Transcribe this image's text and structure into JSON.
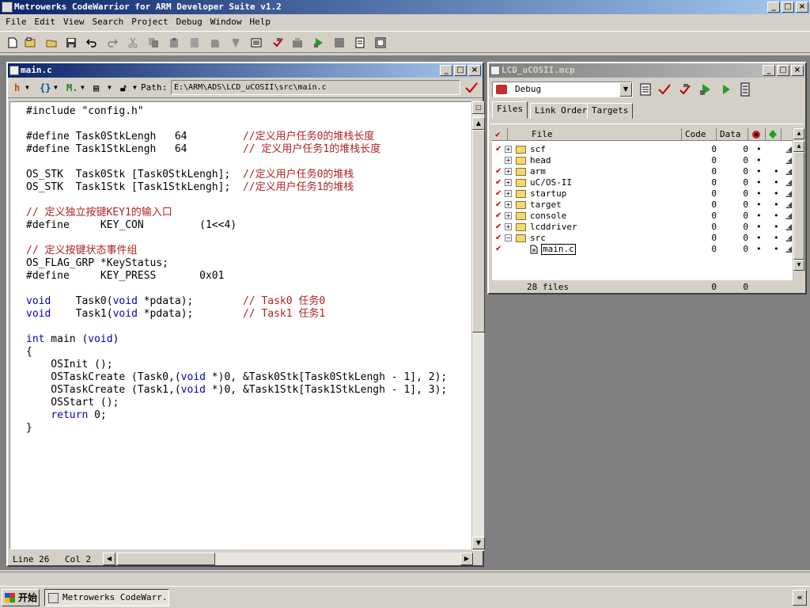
{
  "app": {
    "title": "Metrowerks CodeWarrior for ARM Developer Suite v1.2",
    "minimize": "_",
    "maximize": "□",
    "close": "×"
  },
  "menu": [
    "File",
    "Edit",
    "View",
    "Search",
    "Project",
    "Debug",
    "Window",
    "Help"
  ],
  "toolbar_icons": [
    "new-file-icon",
    "new-project-icon",
    "open-icon",
    "save-icon",
    "undo-icon",
    "redo-icon",
    "cut-icon",
    "copy-icon",
    "paste-icon",
    "find-icon",
    "find-next-icon",
    "replace-icon",
    "browser-icon",
    "check-syntax-icon",
    "make-icon",
    "debug-icon",
    "stop-icon",
    "project-settings-icon",
    "target-settings-icon"
  ],
  "editor": {
    "title": "main.c",
    "path_label": "Path:",
    "path": "E:\\ARM\\ADS\\LCD_uCOSII\\src\\main.c",
    "tools": {
      "bookmark": "h",
      "functions": "{}",
      "markers": "M.",
      "file_ops": "▤"
    },
    "code": [
      {
        "t": [
          [
            "",
            "#include \"config.h\""
          ]
        ]
      },
      {
        "t": []
      },
      {
        "t": [
          [
            "",
            "#define Task0StkLengh   64         "
          ],
          [
            "cm",
            "//定义用户任务0的堆栈长度"
          ]
        ]
      },
      {
        "t": [
          [
            "",
            "#define Task1StkLengh   64         "
          ],
          [
            "cm",
            "// 定义用户任务1的堆栈长度"
          ]
        ]
      },
      {
        "t": []
      },
      {
        "t": [
          [
            "",
            "OS_STK  Task0Stk [Task0StkLengh];  "
          ],
          [
            "cm",
            "//定义用户任务0的堆栈"
          ]
        ]
      },
      {
        "t": [
          [
            "",
            "OS_STK  Task1Stk [Task1StkLengh];  "
          ],
          [
            "cm",
            "//定义用户任务1的堆栈"
          ]
        ]
      },
      {
        "t": []
      },
      {
        "t": [
          [
            "cm",
            "// 定义独立按键KEY1的输入口"
          ]
        ]
      },
      {
        "t": [
          [
            "",
            "#define     KEY_CON         (1<<4)"
          ]
        ]
      },
      {
        "t": []
      },
      {
        "t": [
          [
            "cm",
            "// 定义按键状态事件组"
          ]
        ]
      },
      {
        "t": [
          [
            "",
            "OS_FLAG_GRP *KeyStatus;"
          ]
        ]
      },
      {
        "t": [
          [
            "",
            "#define     KEY_PRESS       0x01"
          ]
        ]
      },
      {
        "t": []
      },
      {
        "t": [
          [
            "kw",
            "void"
          ],
          [
            "",
            "    Task0("
          ],
          [
            "kw",
            "void"
          ],
          [
            "",
            " *pdata);        "
          ],
          [
            "cm",
            "// Task0 任务0"
          ]
        ]
      },
      {
        "t": [
          [
            "kw",
            "void"
          ],
          [
            "",
            "    Task1("
          ],
          [
            "kw",
            "void"
          ],
          [
            "",
            " *pdata);        "
          ],
          [
            "cm",
            "// Task1 任务1"
          ]
        ]
      },
      {
        "t": []
      },
      {
        "t": [
          [
            "kw",
            "int"
          ],
          [
            "",
            " main ("
          ],
          [
            "kw",
            "void"
          ],
          [
            "",
            ")"
          ]
        ]
      },
      {
        "t": [
          [
            "",
            "{"
          ]
        ]
      },
      {
        "t": [
          [
            "",
            "    OSInit ();"
          ]
        ]
      },
      {
        "t": [
          [
            "",
            "    OSTaskCreate (Task0,("
          ],
          [
            "kw",
            "void"
          ],
          [
            "",
            " *)0, &Task0Stk[Task0StkLengh - 1], 2);"
          ]
        ]
      },
      {
        "t": [
          [
            "",
            "    OSTaskCreate (Task1,("
          ],
          [
            "kw",
            "void"
          ],
          [
            "",
            " *)0, &Task1Stk[Task1StkLengh - 1], 3);"
          ]
        ]
      },
      {
        "t": [
          [
            "",
            "    OSStart ();"
          ]
        ]
      },
      {
        "t": [
          [
            "",
            "    "
          ],
          [
            "kw",
            "return"
          ],
          [
            "",
            " 0;"
          ]
        ]
      },
      {
        "t": [
          [
            "",
            "}"
          ]
        ]
      }
    ],
    "status": {
      "line": "Line 26",
      "col": "Col 2"
    }
  },
  "project": {
    "title": "LCD_uCOSII.mcp",
    "target": "Debug",
    "tabs": [
      "Files",
      "Link Order",
      "Targets"
    ],
    "columns": {
      "file": "File",
      "code": "Code",
      "data": "Data"
    },
    "files": [
      {
        "name": "scf",
        "expand": "+",
        "checked": true,
        "code": "0",
        "data": "0",
        "dot1": "•",
        "dot2": ""
      },
      {
        "name": "head",
        "expand": "+",
        "checked": false,
        "code": "0",
        "data": "0",
        "dot1": "•",
        "dot2": ""
      },
      {
        "name": "arm",
        "expand": "+",
        "checked": true,
        "code": "0",
        "data": "0",
        "dot1": "•",
        "dot2": "•"
      },
      {
        "name": "uC/OS-II",
        "expand": "+",
        "checked": true,
        "code": "0",
        "data": "0",
        "dot1": "•",
        "dot2": "•"
      },
      {
        "name": "startup",
        "expand": "+",
        "checked": true,
        "code": "0",
        "data": "0",
        "dot1": "•",
        "dot2": "•"
      },
      {
        "name": "target",
        "expand": "+",
        "checked": true,
        "code": "0",
        "data": "0",
        "dot1": "•",
        "dot2": "•"
      },
      {
        "name": "console",
        "expand": "+",
        "checked": true,
        "code": "0",
        "data": "0",
        "dot1": "•",
        "dot2": "•"
      },
      {
        "name": "lcddriver",
        "expand": "+",
        "checked": true,
        "code": "0",
        "data": "0",
        "dot1": "•",
        "dot2": "•"
      },
      {
        "name": "src",
        "expand": "−",
        "checked": true,
        "code": "0",
        "data": "0",
        "dot1": "•",
        "dot2": "•"
      },
      {
        "name": "main.c",
        "expand": "",
        "checked": true,
        "code": "0",
        "data": "0",
        "dot1": "•",
        "dot2": "•",
        "child": true
      }
    ],
    "footer": {
      "count": "28 files",
      "code": "0",
      "data": "0"
    }
  },
  "taskbar": {
    "start": "开始",
    "task": "Metrowerks CodeWarr...",
    "tray": "«"
  },
  "colors": {
    "titlebar": "#0a246a",
    "keyword": "#0000c0",
    "comment": "#b22222",
    "face": "#d4d0c8"
  }
}
